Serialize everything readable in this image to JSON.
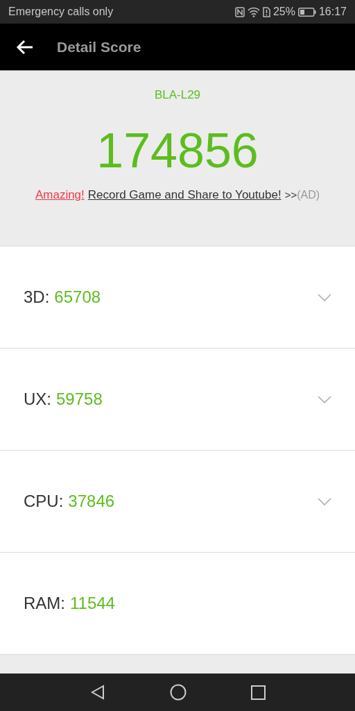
{
  "status_bar": {
    "carrier": "Emergency calls only",
    "battery": "25%",
    "time": "16:17"
  },
  "toolbar": {
    "title": "Detail Score"
  },
  "summary": {
    "device": "BLA-L29",
    "total": "174856",
    "ad": {
      "highlight": "Amazing!",
      "link": "Record Game and Share to Youtube!",
      "arrows": ">>",
      "tag": "(AD)"
    }
  },
  "scores": [
    {
      "label": "3D:",
      "value": "65708",
      "expandable": true
    },
    {
      "label": "UX:",
      "value": "59758",
      "expandable": true
    },
    {
      "label": "CPU:",
      "value": "37846",
      "expandable": true
    },
    {
      "label": "RAM:",
      "value": "11544",
      "expandable": false
    }
  ]
}
